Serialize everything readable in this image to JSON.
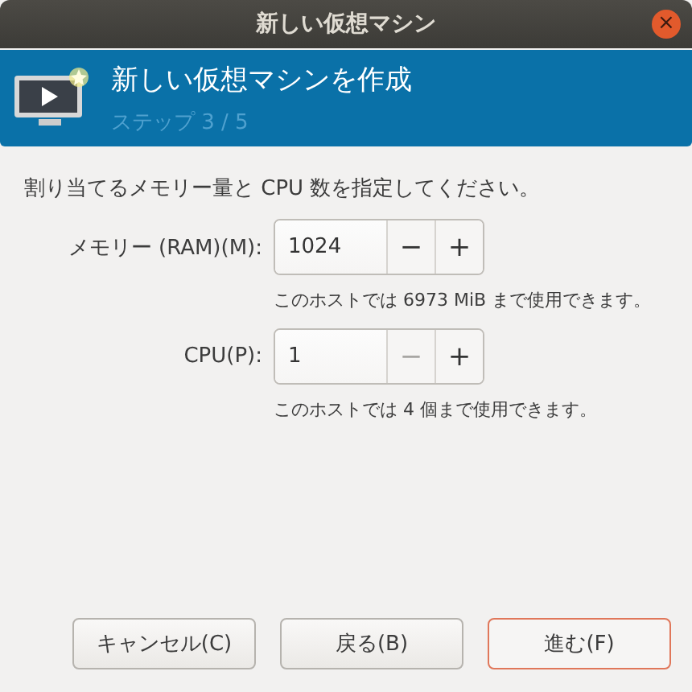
{
  "window": {
    "title": "新しい仮想マシン",
    "close": "×"
  },
  "header": {
    "title": "新しい仮想マシンを作成",
    "step": "ステップ 3 / 5"
  },
  "instruction": "割り当てるメモリー量と CPU 数を指定してください。",
  "spinners": [
    {
      "label": "メモリー (RAM)(M):",
      "value": "1024",
      "minus": "−",
      "plus": "+",
      "minus_disabled": false,
      "hint": "このホストでは 6973 MiB まで使用できます。"
    },
    {
      "label": "CPU(P):",
      "value": "1",
      "minus": "−",
      "plus": "+",
      "minus_disabled": true,
      "hint": "このホストでは 4 個まで使用できます。"
    }
  ],
  "buttons": [
    {
      "label": "キャンセル(C)",
      "default": false
    },
    {
      "label": "戻る(B)",
      "default": false
    },
    {
      "label": "進む(F)",
      "default": true
    }
  ]
}
